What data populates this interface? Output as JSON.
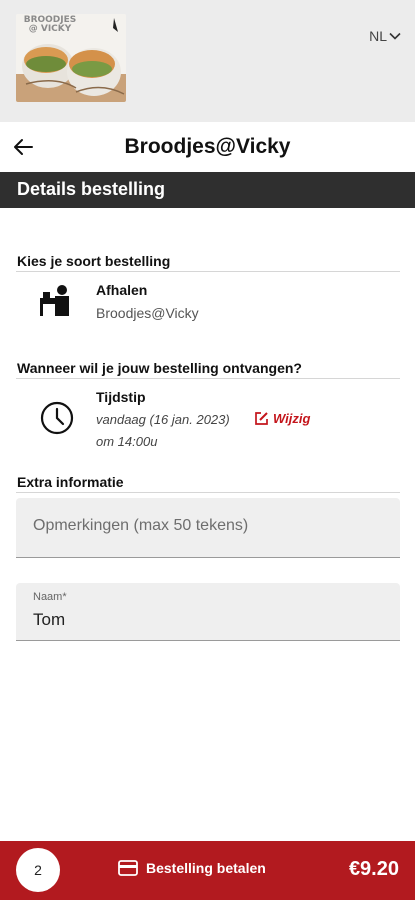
{
  "banner": {
    "logo_text": "BROODJES @ VICKY",
    "language": "NL"
  },
  "header": {
    "title": "Broodjes@Vicky"
  },
  "section": {
    "title": "Details bestelling"
  },
  "order_type": {
    "label": "Kies je soort bestelling",
    "title": "Afhalen",
    "subtitle": "Broodjes@Vicky"
  },
  "timing": {
    "label": "Wanneer wil je jouw bestelling ontvangen?",
    "title": "Tijdstip",
    "date": "vandaag (16 jan. 2023)",
    "edit_label": "Wijzig",
    "time": "om 14:00u"
  },
  "extra": {
    "label": "Extra informatie",
    "remarks_placeholder": "Opmerkingen (max 50 tekens)",
    "remarks_value": "",
    "name_label": "Naam*",
    "name_value": "Tom"
  },
  "footer": {
    "item_count": "2",
    "pay_label": "Bestelling betalen",
    "total": "€9.20"
  },
  "colors": {
    "accent": "#b21a1f",
    "edit": "#c4161c",
    "section_bar": "#2f2f2f"
  }
}
